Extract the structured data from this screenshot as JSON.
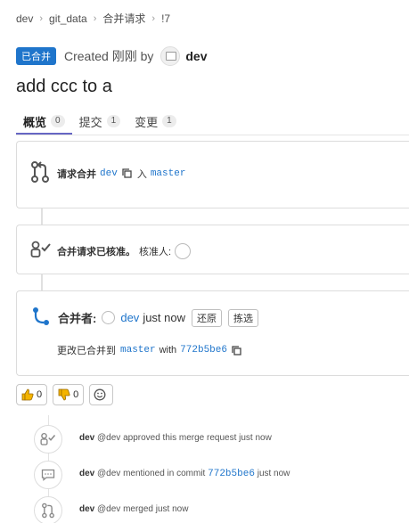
{
  "breadcrumb": {
    "items": [
      "dev",
      "git_data",
      "合并请求",
      "!7"
    ]
  },
  "header": {
    "status_badge": "已合并",
    "created_text": "Created 刚刚 by",
    "author": "dev"
  },
  "title": "add ccc to a",
  "tabs": [
    {
      "label": "概览",
      "count": "0"
    },
    {
      "label": "提交",
      "count": "1"
    },
    {
      "label": "变更",
      "count": "1"
    }
  ],
  "merge_request_card": {
    "label": "请求合并",
    "source_branch": "dev",
    "into_label": "入",
    "target_branch": "master"
  },
  "approval_card": {
    "status_text": "合并请求已核准。",
    "approvers_label": "核准人:"
  },
  "merged_card": {
    "label": "合并者:",
    "user": "dev",
    "time": "just now",
    "revert_button": "还原",
    "cherry_pick_button": "拣选",
    "changes_label": "更改已合并到",
    "branch": "master",
    "with_label": "with",
    "commit": "772b5be6"
  },
  "reactions": {
    "thumbs_up_count": "0",
    "thumbs_down_count": "0"
  },
  "timeline": [
    {
      "author": "dev",
      "handle": "@dev",
      "text": "approved this merge request just now"
    },
    {
      "author": "dev",
      "handle": "@dev",
      "text_before": "mentioned in commit",
      "commit": "772b5be6",
      "text_after": "just now"
    },
    {
      "author": "dev",
      "handle": "@dev",
      "text": "merged just now"
    }
  ],
  "colors": {
    "accent": "#1f75cb",
    "tab_underline": "#6666c4",
    "merged_badge": "#1f75cb"
  }
}
